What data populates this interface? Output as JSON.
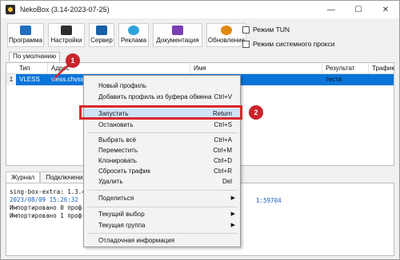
{
  "window": {
    "title": "NekoBox (3.14-2023-07-25)"
  },
  "win_controls": {
    "minimize": "—",
    "maximize": "☐",
    "close": "✕"
  },
  "toolbar": {
    "program": "Программа",
    "settings": "Настройки",
    "server": "Сервер",
    "ads": "Реклама",
    "docs": "Документация",
    "update": "Обновление"
  },
  "checkboxes": {
    "tun_mode": "Режим TUN",
    "system_proxy": "Режим системного прокси"
  },
  "group_tab": "По умолчанию",
  "table": {
    "headers": [
      "Тип",
      "Адрес",
      "Имя",
      "Результат теста",
      "Трафик"
    ],
    "rows": [
      {
        "num": "1",
        "type": "VLESS",
        "address": "vless.chvss.ru:443"
      }
    ]
  },
  "log_tabs": [
    "Журнал",
    "Подключения"
  ],
  "log": {
    "lines": [
      "sing-box-extra: 1.3.4",
      "2023/08/09 15:26:32",
      "Импортировано 0 проф",
      "Импортировано 1 проф"
    ],
    "port": "1:59704"
  },
  "context_menu": {
    "items": [
      {
        "label": "Новый профиль",
        "shortcut": ""
      },
      {
        "label": "Добавить профиль из буфера обмена",
        "shortcut": "Ctrl+V"
      },
      {
        "label": "Запустить",
        "shortcut": "Return"
      },
      {
        "label": "Остановить",
        "shortcut": "Ctrl+S"
      },
      {
        "label": "Выбрать всё",
        "shortcut": "Ctrl+A"
      },
      {
        "label": "Переместить",
        "shortcut": "Ctrl+M"
      },
      {
        "label": "Клонировать",
        "shortcut": "Ctrl+D"
      },
      {
        "label": "Сбросить трафик",
        "shortcut": "Ctrl+R"
      },
      {
        "label": "Удалить",
        "shortcut": "Del"
      },
      {
        "label": "Поделиться",
        "shortcut": ""
      },
      {
        "label": "Текущий выбор",
        "shortcut": ""
      },
      {
        "label": "Текущая группа",
        "shortcut": ""
      },
      {
        "label": "Отладочная информация",
        "shortcut": ""
      }
    ]
  },
  "annotations": {
    "step1": "1",
    "step2": "2"
  },
  "colors": {
    "selection": "#0a74d9",
    "highlight": "#cde3f7",
    "annotation": "#d9262c"
  }
}
